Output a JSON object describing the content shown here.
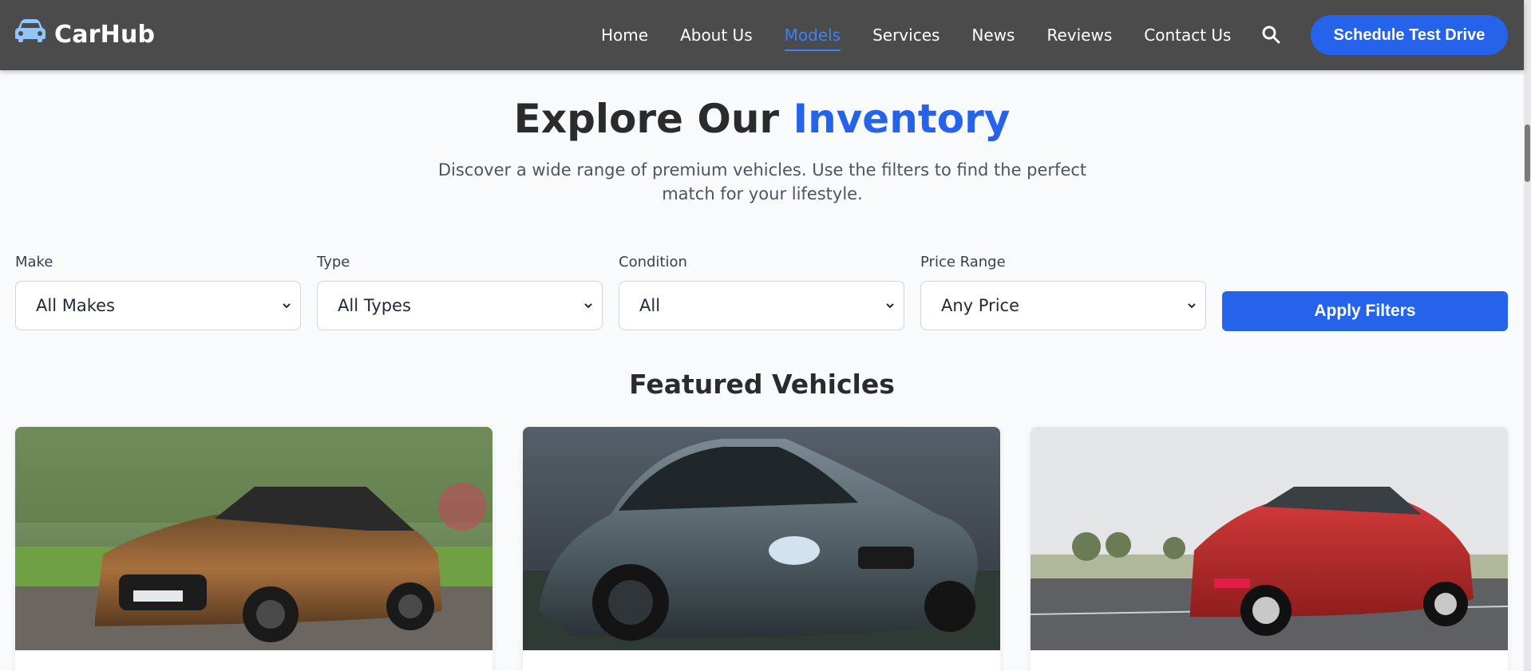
{
  "brand": {
    "name": "CarHub",
    "icon": "car-icon"
  },
  "nav": {
    "links": [
      "Home",
      "About Us",
      "Models",
      "Services",
      "News",
      "Reviews",
      "Contact Us"
    ],
    "active": "Models",
    "search_icon": "search-icon",
    "cta": "Schedule Test Drive"
  },
  "hero": {
    "title_main": "Explore Our ",
    "title_accent": "Inventory",
    "subtitle": "Discover a wide range of premium vehicles. Use the filters to find the perfect match for your lifestyle."
  },
  "filters": {
    "make": {
      "label": "Make",
      "value": "All Makes"
    },
    "type": {
      "label": "Type",
      "value": "All Types"
    },
    "condition": {
      "label": "Condition",
      "value": "All"
    },
    "price": {
      "label": "Price Range",
      "value": "Any Price"
    },
    "apply": "Apply Filters"
  },
  "featured": {
    "title": "Featured Vehicles",
    "cards": [
      {
        "image": "bronze luxury sedan photo"
      },
      {
        "image": "grey sports coupe photo"
      },
      {
        "image": "red compact SUV photo"
      }
    ]
  },
  "colors": {
    "navbar": "#4b4b4b",
    "accent": "#2563eb",
    "background": "#f8fafc"
  }
}
